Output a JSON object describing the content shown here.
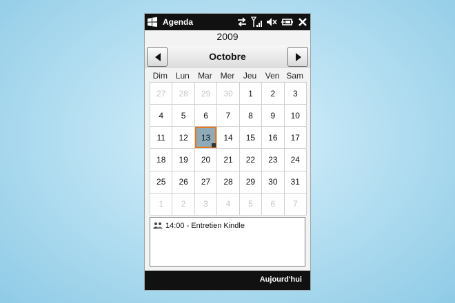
{
  "status_bar": {
    "app_title": "Agenda",
    "icons": [
      "windows-logo-icon",
      "data-sync-icon",
      "signal-strength-icon",
      "volume-muted-icon",
      "battery-charging-icon",
      "close-icon"
    ]
  },
  "calendar": {
    "year": "2009",
    "month": "Octobre",
    "prev_icon": "chevron-left-icon",
    "next_icon": "chevron-right-icon",
    "weekdays": [
      "Dim",
      "Lun",
      "Mar",
      "Mer",
      "Jeu",
      "Ven",
      "Sam"
    ],
    "weeks": [
      [
        {
          "d": "27",
          "other": true
        },
        {
          "d": "28",
          "other": true
        },
        {
          "d": "29",
          "other": true
        },
        {
          "d": "30",
          "other": true
        },
        {
          "d": "1"
        },
        {
          "d": "2"
        },
        {
          "d": "3"
        }
      ],
      [
        {
          "d": "4"
        },
        {
          "d": "5"
        },
        {
          "d": "6"
        },
        {
          "d": "7"
        },
        {
          "d": "8"
        },
        {
          "d": "9"
        },
        {
          "d": "10"
        }
      ],
      [
        {
          "d": "11"
        },
        {
          "d": "12"
        },
        {
          "d": "13",
          "selected": true,
          "has_appointment": true
        },
        {
          "d": "14"
        },
        {
          "d": "15"
        },
        {
          "d": "16"
        },
        {
          "d": "17"
        }
      ],
      [
        {
          "d": "18"
        },
        {
          "d": "19"
        },
        {
          "d": "20"
        },
        {
          "d": "21"
        },
        {
          "d": "22"
        },
        {
          "d": "23"
        },
        {
          "d": "24"
        }
      ],
      [
        {
          "d": "25"
        },
        {
          "d": "26"
        },
        {
          "d": "27"
        },
        {
          "d": "28"
        },
        {
          "d": "29"
        },
        {
          "d": "30"
        },
        {
          "d": "31"
        }
      ],
      [
        {
          "d": "1",
          "other": true
        },
        {
          "d": "2",
          "other": true
        },
        {
          "d": "3",
          "other": true
        },
        {
          "d": "4",
          "other": true
        },
        {
          "d": "5",
          "other": true
        },
        {
          "d": "6",
          "other": true
        },
        {
          "d": "7",
          "other": true
        }
      ]
    ],
    "selected_color": "#8faab8",
    "selected_border_color": "#e07a1b"
  },
  "appointments": [
    {
      "icon": "meeting-icon",
      "text": "14:00 - Entretien Kindle"
    }
  ],
  "softkeys": {
    "right": "Aujourd'hui"
  }
}
